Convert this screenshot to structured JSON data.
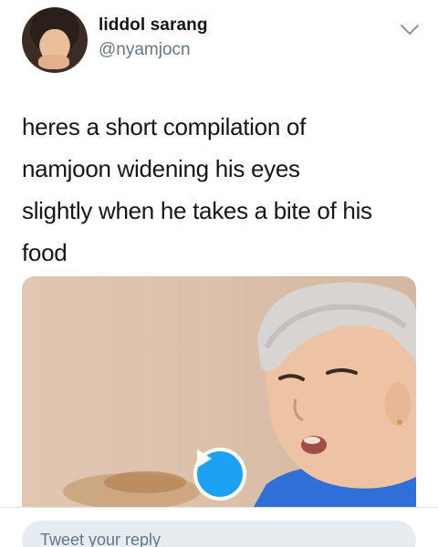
{
  "tweet": {
    "author_name": "liddol sarang",
    "author_handle": "@nyamjocn",
    "text": "heres a short compilation of namjoon widening his eyes slightly when he takes a bite of his food",
    "lines": [
      "heres a short compilation of",
      "namjoon widening his eyes",
      "slightly when he takes a bite of his",
      "food"
    ]
  },
  "icons": {
    "menu": "chevron-down-icon",
    "play": "play-icon"
  },
  "media": {
    "type": "video"
  },
  "reply": {
    "placeholder": "Tweet your reply"
  },
  "colors": {
    "accent": "#1da1f2",
    "secondary_text": "#657786",
    "input_bg": "#e6ecf0"
  }
}
